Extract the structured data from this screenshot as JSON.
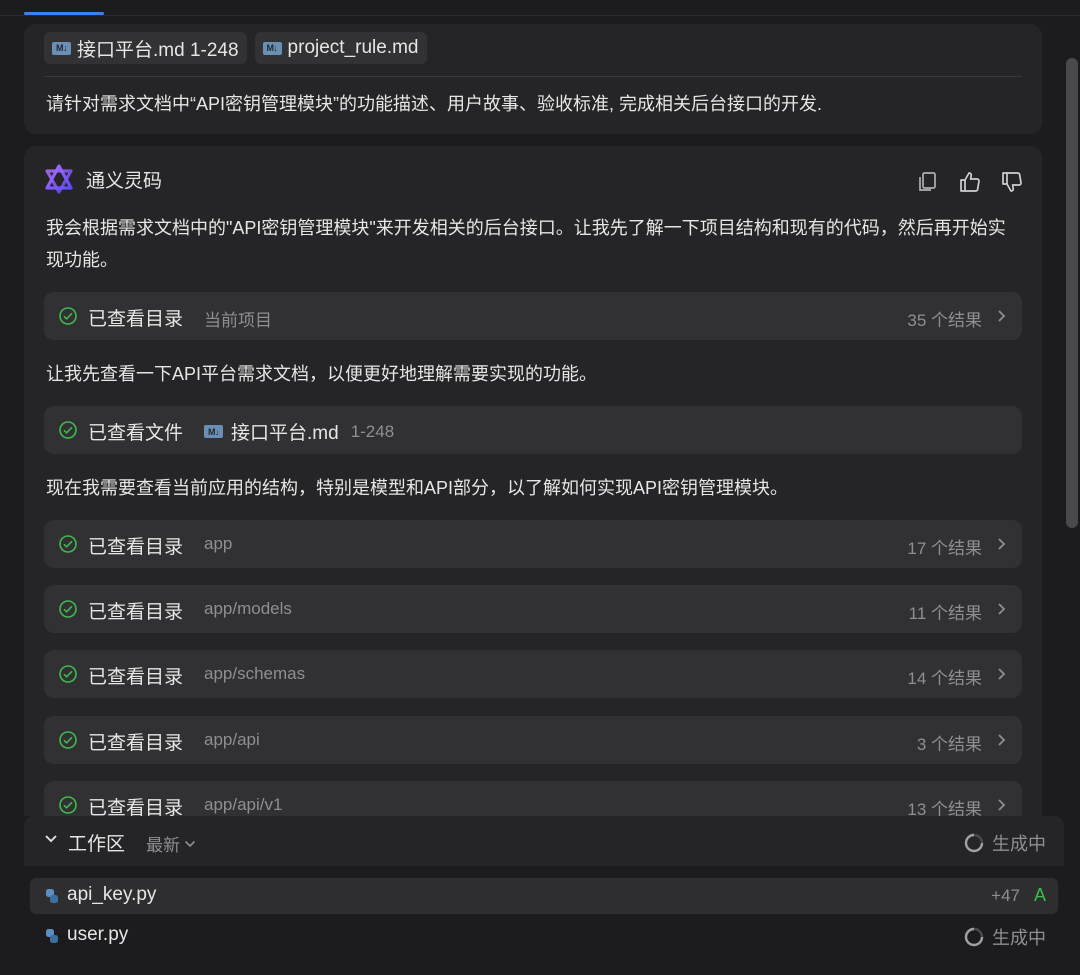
{
  "user": {
    "chips": [
      {
        "label": "接口平台.md 1-248",
        "icon": "markdown-icon"
      },
      {
        "label": "project_rule.md",
        "icon": "markdown-icon"
      }
    ],
    "message": "请针对需求文档中“API密钥管理模块”的功能描述、用户故事、验收标准, 完成相关后台接口的开发."
  },
  "ai": {
    "name": "通义灵码",
    "actions": [
      "copy-icon",
      "thumbs-up-icon",
      "thumbs-down-icon"
    ],
    "para1": "我会根据需求文档中的\"API密钥管理模块\"来开发相关的后台接口。让我先了解一下项目结构和现有的代码，然后再开始实现功能。",
    "tool_dir_current": {
      "action": "已查看目录",
      "target": "当前项目",
      "count": "35 个结果"
    },
    "para2": "让我先查看一下API平台需求文档，以便更好地理解需要实现的功能。",
    "tool_file": {
      "action": "已查看文件",
      "file": "接口平台.md",
      "range": "1-248"
    },
    "para3": "现在我需要查看当前应用的结构，特别是模型和API部分，以了解如何实现API密钥管理模块。",
    "tools": [
      {
        "action": "已查看目录",
        "target": "app",
        "count": "17 个结果"
      },
      {
        "action": "已查看目录",
        "target": "app/models",
        "count": "11 个结果"
      },
      {
        "action": "已查看目录",
        "target": "app/schemas",
        "count": "14 个结果"
      },
      {
        "action": "已查看目录",
        "target": "app/api",
        "count": "3 个结果"
      },
      {
        "action": "已查看目录",
        "target": "app/api/v1",
        "count": "13 个结果"
      }
    ]
  },
  "workspace": {
    "title": "工作区",
    "filter": "最新",
    "status": "生成中",
    "files": [
      {
        "name": "api_key.py",
        "changes": "+47",
        "state": "A"
      },
      {
        "name": "user.py",
        "status": "生成中"
      }
    ]
  },
  "colors": {
    "accent": "#3b82f6",
    "success": "#3fb950",
    "added": "#3fb950"
  }
}
